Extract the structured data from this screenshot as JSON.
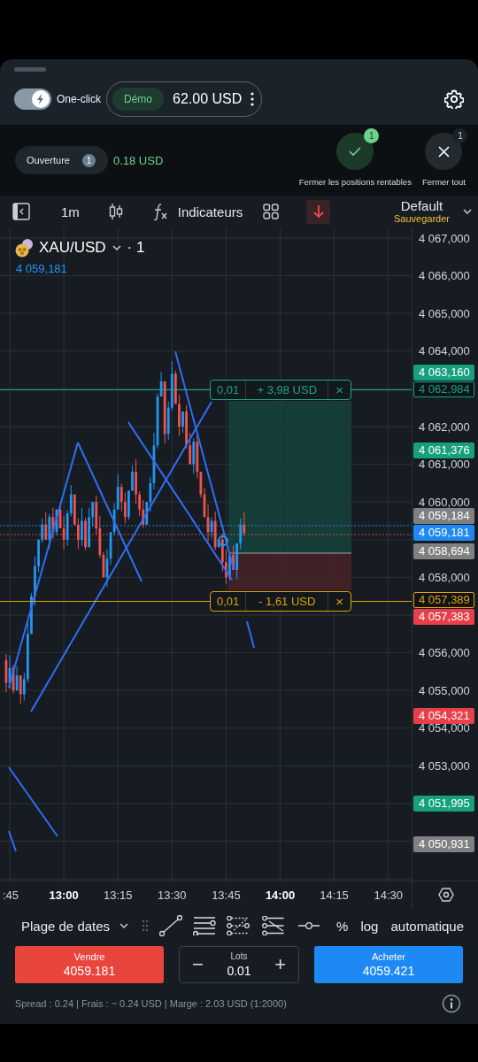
{
  "header": {
    "one_click": {
      "label": "One-click",
      "on": true
    },
    "account": {
      "badge": "Démo",
      "balance": "62.00 USD"
    }
  },
  "positions": {
    "label": "Ouverture",
    "count": "1",
    "profit": "0.18 USD",
    "actions": [
      {
        "kind": "profitable",
        "label": "Fermer les positions rentables",
        "count": "1"
      },
      {
        "kind": "all",
        "label": "Fermer tout",
        "count": "1"
      }
    ]
  },
  "toolbar": {
    "interval": "1m",
    "indicators": "Indicateurs",
    "layout": "Default",
    "save": "Sauvegarder"
  },
  "chart": {
    "symbol": "XAU/USD",
    "timeframe": "· 1",
    "last_price": "4 059,181",
    "price_ticks": [
      "4 067,000",
      "4 066,000",
      "4 065,000",
      "4 064,000",
      "4 062,000",
      "4 061,000",
      "4 060,000",
      "4 058,000",
      "4 056,000",
      "4 055,000",
      "4 054,000",
      "4 053,000"
    ],
    "price_tags": [
      {
        "text": "4 063,160",
        "kind": "fill",
        "color": "#17a07f"
      },
      {
        "text": "4 062,984",
        "kind": "outline",
        "color": "#17a07f"
      },
      {
        "text": "4 061,376",
        "kind": "fill",
        "color": "#17a07f"
      },
      {
        "text": "4 059,184",
        "kind": "fill",
        "color": "#808080"
      },
      {
        "text": "4 059,181",
        "kind": "current",
        "color": "#1e88f5"
      },
      {
        "text": "4 058,694",
        "kind": "fill",
        "color": "#808080"
      },
      {
        "text": "4 057,389",
        "kind": "outline",
        "color": "#e3a008"
      },
      {
        "text": "4 057,383",
        "kind": "fill",
        "color": "#e8404a"
      },
      {
        "text": "4 054,321",
        "kind": "fill",
        "color": "#e8404a"
      },
      {
        "text": "4 051,995",
        "kind": "fill",
        "color": "#17a07f"
      },
      {
        "text": "4 050,931",
        "kind": "fill",
        "color": "#808080"
      }
    ],
    "orders": [
      {
        "kind": "take_profit",
        "lots": "0,01",
        "pnl": "+ 3,98 USD",
        "close": "×",
        "color": "#1fa585"
      },
      {
        "kind": "stop_loss",
        "lots": "0,01",
        "pnl": "- 1,61 USD",
        "close": "×",
        "color": "#e3a008"
      }
    ],
    "time_ticks": [
      {
        "label": ":45",
        "bold": false
      },
      {
        "label": "13:00",
        "bold": true
      },
      {
        "label": "13:15",
        "bold": false
      },
      {
        "label": "13:30",
        "bold": false
      },
      {
        "label": "13:45",
        "bold": false
      },
      {
        "label": "14:00",
        "bold": true
      },
      {
        "label": "14:15",
        "bold": false
      },
      {
        "label": "14:30",
        "bold": false
      }
    ]
  },
  "tools": {
    "date_range": "Plage de dates",
    "percent": "%",
    "log": "log",
    "auto": "automatique"
  },
  "order": {
    "sell": {
      "label": "Vendre",
      "price": "4059.181"
    },
    "lots": {
      "label": "Lots",
      "value": "0.01",
      "minus": "−",
      "plus": "+"
    },
    "buy": {
      "label": "Acheter",
      "price": "4059.421"
    }
  },
  "footer": {
    "info": "Spread : 0.24 | Frais : ~ 0.24 USD | Marge : 2.03 USD (1:2000)"
  }
}
